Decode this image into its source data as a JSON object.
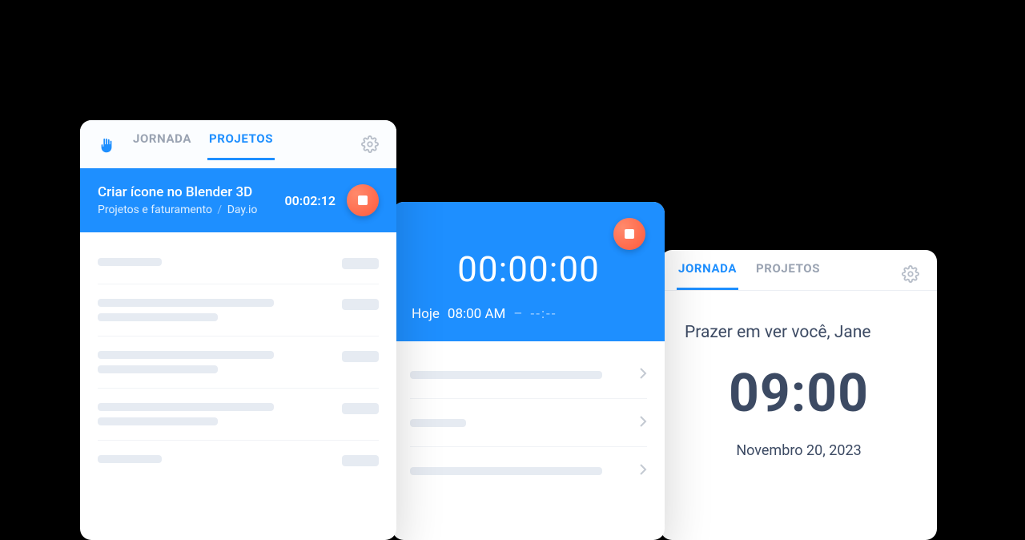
{
  "card1": {
    "tabs": {
      "jornada": "JORNADA",
      "projetos": "PROJETOS"
    },
    "active_task": {
      "title": "Criar ícone no Blender 3D",
      "project": "Projetos e faturamento",
      "client": "Day.io",
      "elapsed": "00:02:12"
    }
  },
  "card2": {
    "timer": "00:00:00",
    "today_label": "Hoje",
    "start_time": "08:00 AM",
    "sep": "–",
    "end_time": "--:--"
  },
  "card3": {
    "tabs": {
      "jornada": "JORNADA",
      "projetos": "PROJETOS"
    },
    "greeting": "Prazer em ver você, Jane",
    "clock": "09:00",
    "date": "Novembro 20, 2023"
  }
}
